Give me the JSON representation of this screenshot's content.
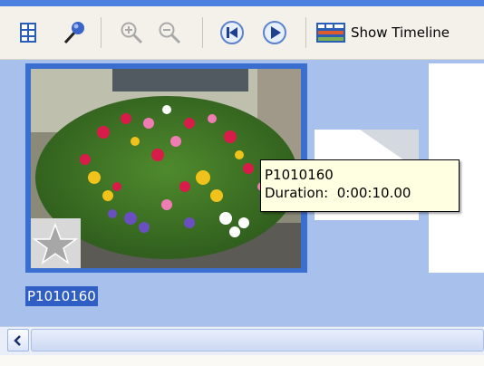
{
  "toolbar": {
    "items": [
      {
        "icon": "storyboard-icon"
      },
      {
        "icon": "narrate-microphone-icon"
      },
      {
        "icon": "zoom-in-icon"
      },
      {
        "icon": "zoom-out-icon"
      },
      {
        "icon": "rewind-icon"
      },
      {
        "icon": "play-icon"
      },
      {
        "icon": "timeline-icon"
      }
    ],
    "show_timeline_label": "Show Timeline"
  },
  "clip": {
    "name": "P1010160",
    "tooltip_name": "P1010160",
    "tooltip_duration": "Duration:  0:00:10.00"
  },
  "colors": {
    "accent": "#4b7fe0",
    "storyboard_bg": "#a8c0ec",
    "selection": "#3a6fd0",
    "tooltip_bg": "#ffffe1"
  }
}
